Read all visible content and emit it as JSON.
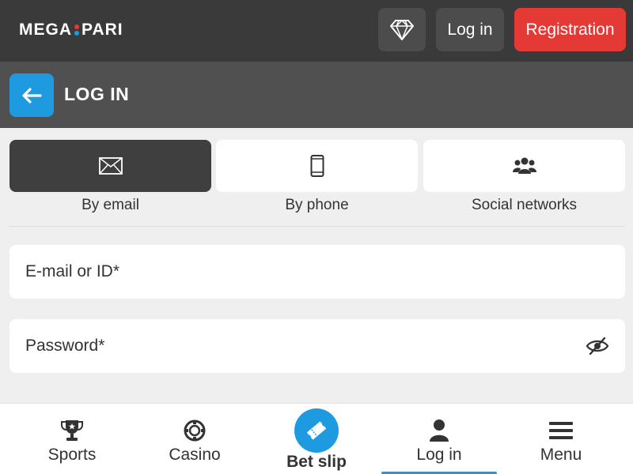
{
  "header": {
    "logo_left": "MEGA",
    "logo_right": "PARI",
    "diamond_icon": "diamond-icon",
    "login_label": "Log in",
    "register_label": "Registration"
  },
  "titlebar": {
    "back_icon": "arrow-left-icon",
    "title": "LOG IN"
  },
  "methods": [
    {
      "label": "By email",
      "icon": "envelope-icon",
      "active": true
    },
    {
      "label": "By phone",
      "icon": "phone-icon",
      "active": false
    },
    {
      "label": "Social networks",
      "icon": "users-icon",
      "active": false
    }
  ],
  "form": {
    "email_placeholder": "E-mail or ID*",
    "email_value": "",
    "password_placeholder": "Password*",
    "password_value": "",
    "password_toggle_icon": "eye-slash-icon"
  },
  "bottom_nav": [
    {
      "label": "Sports",
      "icon": "trophy-icon"
    },
    {
      "label": "Casino",
      "icon": "casino-chip-icon"
    },
    {
      "label": "Bet slip",
      "icon": "ticket-icon"
    },
    {
      "label": "Log in",
      "icon": "user-icon",
      "active": true
    },
    {
      "label": "Menu",
      "icon": "hamburger-icon"
    }
  ],
  "colors": {
    "accent_blue": "#1e9be0",
    "accent_red": "#e53935",
    "header_bg": "#3a3a3a",
    "titlebar_bg": "#505050"
  }
}
